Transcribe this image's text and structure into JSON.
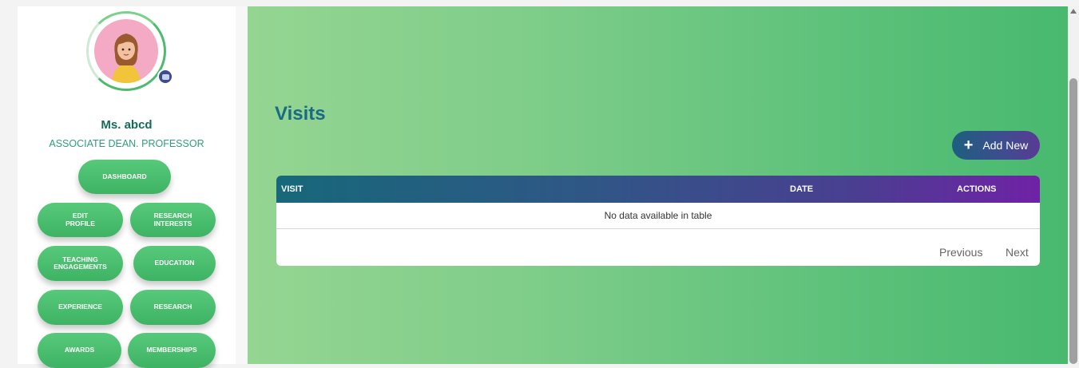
{
  "profile": {
    "name": "Ms. abcd",
    "title": "ASSOCIATE DEAN. PROFESSOR"
  },
  "menu": {
    "dashboard": "DASHBOARD",
    "edit_profile": "EDIT\nPROFILE",
    "research_interests": "RESEARCH\nINTERESTS",
    "teaching_engagements": "TEACHING\nENGAGEMENTS",
    "education": "EDUCATION",
    "experience": "EXPERIENCE",
    "research": "RESEARCH",
    "awards": "AWARDS",
    "memberships": "MEMBERSHIPS"
  },
  "page": {
    "title": "Visits",
    "add_new": "Add New"
  },
  "table": {
    "columns": [
      "VISIT",
      "DATE",
      "ACTIONS"
    ],
    "empty_message": "No data available in table",
    "previous": "Previous",
    "next": "Next"
  },
  "colors": {
    "accent_green": "#3eb364",
    "title_teal": "#1b6a83",
    "header_start": "#17687a",
    "header_end": "#6f22a6"
  },
  "icons": {
    "camera": "camera-icon",
    "plus": "plus-icon"
  }
}
